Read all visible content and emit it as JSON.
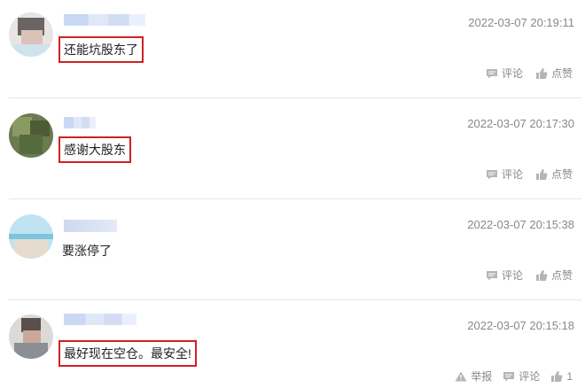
{
  "comments": [
    {
      "username": "",
      "time": "2022-03-07 20:19:11",
      "text": "还能坑股东了",
      "highlighted": true,
      "actions": {
        "comment": "评论",
        "like": "点赞"
      }
    },
    {
      "username": "",
      "time": "2022-03-07 20:17:30",
      "text": "感谢大股东",
      "highlighted": true,
      "actions": {
        "comment": "评论",
        "like": "点赞"
      }
    },
    {
      "username": "",
      "time": "2022-03-07 20:15:38",
      "text": "要涨停了",
      "highlighted": false,
      "actions": {
        "comment": "评论",
        "like": "点赞"
      }
    },
    {
      "username": "",
      "time": "2022-03-07 20:15:18",
      "text": "最好现在空仓。最安全!",
      "highlighted": true,
      "actions": {
        "report": "举报",
        "comment": "评论",
        "like_count": "1"
      }
    }
  ],
  "icons": {
    "comment": "speech-bubble-icon",
    "like": "thumbs-up-icon",
    "report": "warning-triangle-icon"
  },
  "colors": {
    "highlight_border": "#d32020",
    "time_text": "#888888",
    "separator": "#e6e6e6"
  }
}
